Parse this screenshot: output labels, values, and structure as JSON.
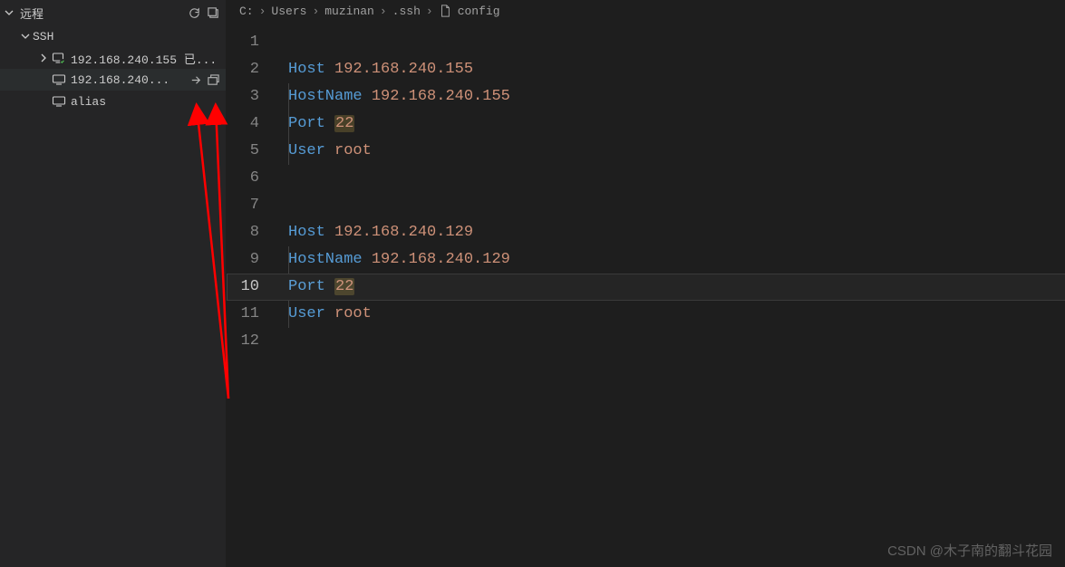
{
  "sidebar": {
    "title": "远程",
    "section": "SSH",
    "items": [
      {
        "label": "192.168.240.155 已..."
      },
      {
        "label": "192.168.240..."
      },
      {
        "label": "alias"
      }
    ]
  },
  "breadcrumb": {
    "parts": [
      "C:",
      "Users",
      "muzinan",
      ".ssh"
    ],
    "file": "config"
  },
  "code": {
    "current_line": 10,
    "lines": [
      {
        "n": 1,
        "segs": []
      },
      {
        "n": 2,
        "segs": [
          {
            "t": "Host ",
            "c": "kw"
          },
          {
            "t": "192.168.240.155",
            "c": "val"
          }
        ]
      },
      {
        "n": 3,
        "indent": true,
        "segs": [
          {
            "t": "HostName ",
            "c": "kw"
          },
          {
            "t": "192.168.240.155",
            "c": "val"
          }
        ]
      },
      {
        "n": 4,
        "indent": true,
        "segs": [
          {
            "t": "Port ",
            "c": "kw"
          },
          {
            "t": "22",
            "c": "val hl"
          }
        ]
      },
      {
        "n": 5,
        "indent": true,
        "segs": [
          {
            "t": "User ",
            "c": "kw"
          },
          {
            "t": "root",
            "c": "val"
          }
        ]
      },
      {
        "n": 6,
        "segs": []
      },
      {
        "n": 7,
        "segs": []
      },
      {
        "n": 8,
        "segs": [
          {
            "t": "Host ",
            "c": "kw"
          },
          {
            "t": "192.168.240.129",
            "c": "val"
          }
        ]
      },
      {
        "n": 9,
        "indent": true,
        "segs": [
          {
            "t": "HostName ",
            "c": "kw"
          },
          {
            "t": "192.168.240.129",
            "c": "val"
          }
        ]
      },
      {
        "n": 10,
        "indent": true,
        "curr": true,
        "segs": [
          {
            "t": "Port ",
            "c": "kw"
          },
          {
            "t": "22",
            "c": "val hl"
          }
        ]
      },
      {
        "n": 11,
        "indent": true,
        "segs": [
          {
            "t": "User ",
            "c": "kw"
          },
          {
            "t": "root",
            "c": "val"
          }
        ]
      },
      {
        "n": 12,
        "segs": []
      }
    ]
  },
  "watermark": "CSDN @木子南的翻斗花园"
}
